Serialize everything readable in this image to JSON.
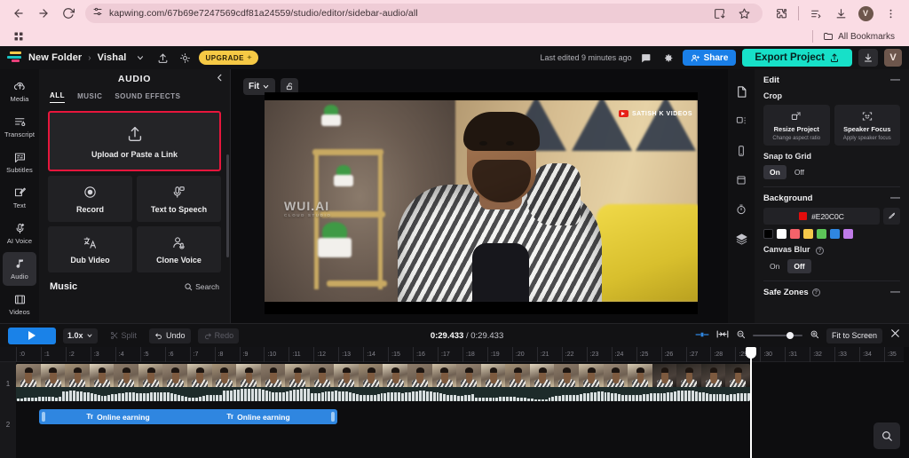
{
  "browser": {
    "back_icon": "back-arrow-icon",
    "forward_icon": "forward-arrow-icon",
    "reload_icon": "reload-icon",
    "site_settings_icon": "site-settings-icon",
    "url": "kapwing.com/67b69e7247569cdf81a24559/studio/editor/sidebar-audio/all",
    "install_icon": "install-app-icon",
    "bookmark_icon": "star-icon",
    "extensions_icon": "extensions-puzzle-icon",
    "reading_list_icon": "reading-list-icon",
    "downloads_icon": "downloads-icon",
    "profile_initial": "V",
    "menu_icon": "three-dot-menu-icon",
    "apps_icon": "apps-grid-icon",
    "all_bookmarks_label": "All Bookmarks"
  },
  "header": {
    "logo": "kapwing-logo",
    "folder": "New Folder",
    "separator": "›",
    "project": "Vishal",
    "chevron_icon": "chevron-down-icon",
    "share_upload_icon": "upload-icon",
    "theme_icon": "brightness-icon",
    "upgrade_label": "UPGRADE",
    "last_edited": "Last edited 9 minutes ago",
    "comment_icon": "comment-icon",
    "settings_icon": "gear-icon",
    "share_label": "Share",
    "export_label": "Export Project",
    "download_icon": "download-icon",
    "avatar_initial": "V"
  },
  "sidebar": {
    "items": [
      {
        "label": "Media",
        "icon": "media-cloud-icon",
        "active": false
      },
      {
        "label": "Transcript",
        "icon": "transcript-icon",
        "active": false
      },
      {
        "label": "Subtitles",
        "icon": "subtitles-icon",
        "active": false
      },
      {
        "label": "Text",
        "icon": "text-edit-icon",
        "active": false
      },
      {
        "label": "AI Voice",
        "icon": "ai-voice-icon",
        "active": false
      },
      {
        "label": "Audio",
        "icon": "audio-note-icon",
        "active": true
      },
      {
        "label": "Videos",
        "icon": "videos-icon",
        "active": false
      }
    ]
  },
  "audio_panel": {
    "title": "AUDIO",
    "collapse_icon": "chevron-left-icon",
    "tabs": [
      {
        "label": "ALL",
        "active": true
      },
      {
        "label": "MUSIC",
        "active": false
      },
      {
        "label": "SOUND EFFECTS",
        "active": false
      }
    ],
    "upload": {
      "label": "Upload or Paste a Link",
      "icon": "upload-arrow-icon",
      "highlight_color": "#E8163C"
    },
    "tiles": [
      {
        "label": "Record",
        "icon": "record-circle-icon"
      },
      {
        "label": "Text to Speech",
        "icon": "microphone-text-icon"
      },
      {
        "label": "Dub Video",
        "icon": "translate-icon"
      },
      {
        "label": "Clone Voice",
        "icon": "clone-voice-icon"
      }
    ],
    "music_title": "Music",
    "search_label": "Search",
    "search_icon": "search-icon"
  },
  "canvas": {
    "fit_label": "Fit",
    "fit_chevron": "chevron-down-icon",
    "lock_icon": "unlock-icon",
    "watermark_main": "WUI.AI",
    "watermark_sub": "CLOUD STUDIO",
    "watermark_channel": "SATISH K VIDEOS",
    "channel_badge_icon": "youtube-play-icon"
  },
  "inspector": {
    "rail_icons": [
      "document-icon",
      "layout-icon",
      "mobile-icon",
      "square-icon",
      "timer-icon",
      "layers-icon"
    ],
    "edit": {
      "title": "Edit",
      "collapse": "—"
    },
    "crop": {
      "label": "Crop",
      "cards": [
        {
          "title": "Resize Project",
          "desc": "Change aspect ratio",
          "icon": "resize-icon"
        },
        {
          "title": "Speaker Focus",
          "desc": "Apply speaker focus",
          "icon": "face-focus-icon"
        }
      ]
    },
    "snap": {
      "label": "Snap to Grid",
      "options": [
        "On",
        "Off"
      ],
      "selected": "On"
    },
    "background": {
      "title": "Background",
      "collapse": "—",
      "hex": "#E20C0C",
      "picker_icon": "eyedropper-icon",
      "swatches": [
        "#000000",
        "#FFFFFF",
        "#F4626A",
        "#F3C84A",
        "#5CC558",
        "#2F86E0",
        "#C07BE8"
      ]
    },
    "canvas_blur": {
      "label": "Canvas Blur",
      "help_icon": "help-icon",
      "options": [
        "On",
        "Off"
      ],
      "selected": "Off"
    },
    "safe_zones": {
      "label": "Safe Zones",
      "help_icon": "help-icon",
      "collapse": "—"
    }
  },
  "playbar": {
    "play_icon": "play-icon",
    "speed": "1.0x",
    "speed_chevron": "chevron-down-icon",
    "split_label": "Split",
    "split_icon": "scissors-icon",
    "undo_label": "Undo",
    "undo_icon": "undo-icon",
    "redo_label": "Redo",
    "redo_icon": "redo-icon",
    "current_time": "0:29.433",
    "time_separator": "/",
    "total_time": "0:29.433",
    "clip_fit_icon": "clip-fit-icon",
    "fit_markers_icon": "fit-between-markers-icon",
    "zoom_out_icon": "zoom-out-icon",
    "zoom_in_icon": "zoom-in-icon",
    "fit_to_screen_label": "Fit to Screen",
    "close_icon": "close-icon"
  },
  "timeline": {
    "ruler_ticks": [
      ":0",
      ":1",
      ":2",
      ":3",
      ":4",
      ":5",
      ":6",
      ":7",
      ":8",
      ":9",
      ":10",
      ":11",
      ":12",
      ":13",
      ":14",
      ":15",
      ":16",
      ":17",
      ":18",
      ":19",
      ":20",
      ":21",
      ":22",
      ":23",
      ":24",
      ":25",
      ":26",
      ":27",
      ":28",
      ":29",
      ":30",
      ":31",
      ":32",
      ":33",
      ":34",
      ":35"
    ],
    "tracks": [
      {
        "number": "1",
        "type": "video",
        "label": ""
      },
      {
        "number": "2",
        "type": "text",
        "label": ""
      }
    ],
    "text_clips": [
      {
        "label": "Online earning",
        "icon": "text-type-icon"
      },
      {
        "label": "Online earning",
        "icon": "text-type-icon"
      }
    ],
    "playhead_time": ":29",
    "search_icon": "search-icon"
  }
}
